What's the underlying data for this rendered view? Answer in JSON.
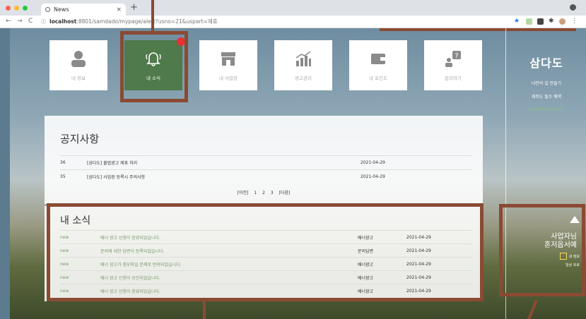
{
  "browser": {
    "tab_title": "News",
    "tab_close": "×",
    "new_tab": "+",
    "url_host": "localhost",
    "url_rest": ":8801/samdado/mypage/alert?usno=21&uspart=제휴",
    "colors": {
      "red": "#ff5f57",
      "yellow": "#febc2e",
      "green": "#28c840"
    }
  },
  "cards": [
    {
      "label": "내 정보",
      "icon": "user-icon",
      "active": false
    },
    {
      "label": "내 소식",
      "icon": "bell-icon",
      "active": true
    },
    {
      "label": "내 사업장",
      "icon": "store-icon",
      "active": false
    },
    {
      "label": "광고관리",
      "icon": "chart-icon",
      "active": false
    },
    {
      "label": "내 포인트",
      "icon": "wallet-icon",
      "active": false
    },
    {
      "label": "문의하기",
      "icon": "question-icon",
      "active": false
    }
  ],
  "notice": {
    "title": "공지사항",
    "rows": [
      {
        "num": "36",
        "title": "[삼다도] 불법광고 제휴 처리",
        "date": "2021-04-29"
      },
      {
        "num": "35",
        "title": "[삼다도] 사업장 등록시 주의사항",
        "date": "2021-04-29"
      }
    ],
    "pager": {
      "prev": "[이전]",
      "pages": [
        "1",
        "2",
        "3"
      ],
      "next": "[다음]"
    }
  },
  "news": {
    "title": "내 소식",
    "rows": [
      {
        "tag": "new",
        "title": "배너 광고 신청이 완료되었습니다.",
        "category": "배너광고",
        "date": "2021-04-29"
      },
      {
        "tag": "new",
        "title": "문의에 대한 답변이 등록되었습니다.",
        "category": "문의답변",
        "date": "2021-04-29"
      },
      {
        "tag": "new",
        "title": "배너 광고가 첨부파일 문제로 반려되었습니다.",
        "category": "배너광고",
        "date": "2021-04-29"
      },
      {
        "tag": "new",
        "title": "배너 광고 신청이 승인되었습니다.",
        "category": "배너광고",
        "date": "2021-04-29"
      },
      {
        "tag": "new",
        "title": "배너 광고 신청이 완료되었습니다.",
        "category": "배너광고",
        "date": "2021-04-29"
      }
    ]
  },
  "sidebar": {
    "brand": "삼다도",
    "menu": [
      "나만의 길 만들기",
      "제주도 필수 예약",
      "삼다도에서 사업하기"
    ],
    "promo": {
      "line1": "사업자님",
      "line2": "혼저옵서예",
      "mini_label": "내 정보",
      "sub_label": "일상 흐로"
    }
  },
  "accent": "#8a4a33"
}
